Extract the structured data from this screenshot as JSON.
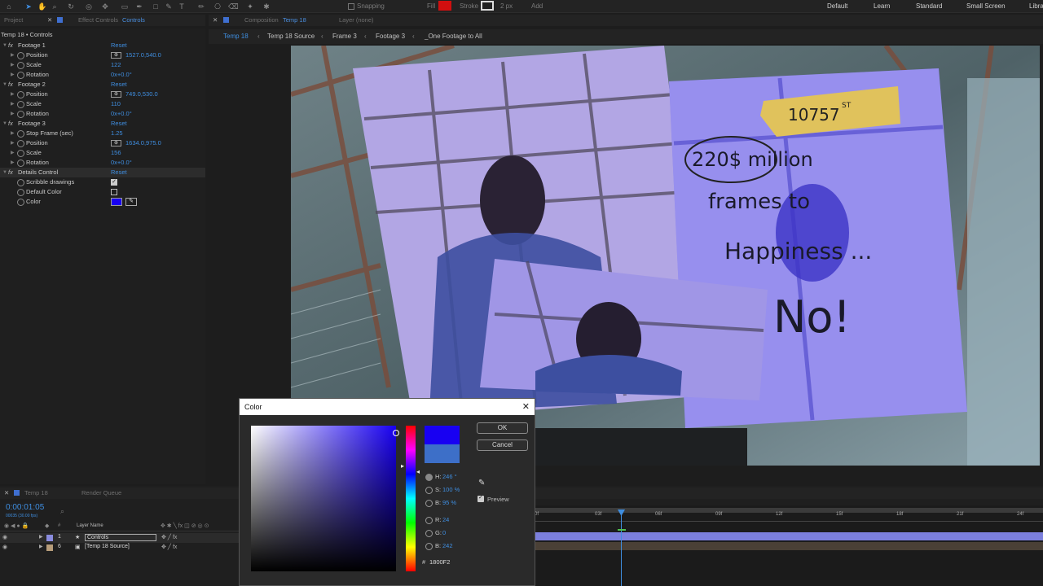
{
  "toolbar": {
    "snapping_label": "Snapping",
    "fill_label": "Fill",
    "stroke_label": "Stroke",
    "stroke_px": "2 px",
    "add_label": "Add",
    "workspaces": [
      "Default",
      "Learn",
      "Standard",
      "Small Screen",
      "Libra"
    ]
  },
  "panels": {
    "project_tab": "Project",
    "effect_controls_prefix": "Effect Controls",
    "effect_controls_layer": "Controls",
    "composition_prefix": "Composition",
    "composition_name": "Temp 18",
    "layer_tab": "Layer (none)"
  },
  "effect_controls": {
    "header": "Temp 18 • Controls",
    "groups": [
      {
        "name": "Footage 1",
        "reset": "Reset",
        "props": [
          {
            "name": "Position",
            "value": "1527.0,540.0",
            "type": "point"
          },
          {
            "name": "Scale",
            "value": "122",
            "type": "num"
          },
          {
            "name": "Rotation",
            "value": "0x+0.0°",
            "type": "num"
          }
        ]
      },
      {
        "name": "Footage 2",
        "reset": "Reset",
        "props": [
          {
            "name": "Position",
            "value": "749.0,530.0",
            "type": "point"
          },
          {
            "name": "Scale",
            "value": "110",
            "type": "num"
          },
          {
            "name": "Rotation",
            "value": "0x+0.0°",
            "type": "num"
          }
        ]
      },
      {
        "name": "Footage 3",
        "reset": "Reset",
        "props": [
          {
            "name": "Stop Frame (sec)",
            "value": "1.25",
            "type": "num"
          },
          {
            "name": "Position",
            "value": "1634.0,975.0",
            "type": "point"
          },
          {
            "name": "Scale",
            "value": "156",
            "type": "num"
          },
          {
            "name": "Rotation",
            "value": "0x+0.0°",
            "type": "num"
          }
        ]
      },
      {
        "name": "Details Control",
        "reset": "Reset",
        "props": [
          {
            "name": "Scribble drawings",
            "value": "",
            "type": "check"
          },
          {
            "name": "Default Color",
            "value": "",
            "type": "check-off"
          },
          {
            "name": "Color",
            "value": "",
            "type": "color"
          }
        ]
      }
    ]
  },
  "breadcrumbs": [
    "Temp 18",
    "Temp 18 Source",
    "Frame 3",
    "Footage 3",
    "_One Footage to All"
  ],
  "viewer": {
    "tag_text": "10757",
    "tag_sup": "ST",
    "scribble_lines": [
      "220$ million",
      "frames to",
      "Happiness ...",
      "No!"
    ]
  },
  "timeline": {
    "tabs": [
      "Temp 18",
      "Render Queue"
    ],
    "timecode": "0:00:01:05",
    "timecode_sub": "00035 (30.00 fps)",
    "layer_header": "Layer Name",
    "layers": [
      {
        "num": "1",
        "name": "Controls",
        "color": "#8a8cdf"
      },
      {
        "num": "6",
        "name": "[Temp 18 Source]",
        "color": "#b69c7a"
      }
    ],
    "ruler": [
      "0f",
      "03f",
      "06f",
      "09f",
      "12f",
      "15f",
      "18f",
      "21f",
      "24f",
      "27f"
    ]
  },
  "color_dialog": {
    "title": "Color",
    "ok": "OK",
    "cancel": "Cancel",
    "preview_label": "Preview",
    "fields": [
      {
        "label": "H:",
        "value": "246 °"
      },
      {
        "label": "S:",
        "value": "100 %"
      },
      {
        "label": "B:",
        "value": "95 %"
      },
      {
        "label": "R:",
        "value": "24"
      },
      {
        "label": "G:",
        "value": "0"
      },
      {
        "label": "B:",
        "value": "242"
      }
    ],
    "hex_prefix": "#",
    "hex": "1800F2",
    "new_color": "#1800f2",
    "old_color": "#3d6fc8"
  }
}
